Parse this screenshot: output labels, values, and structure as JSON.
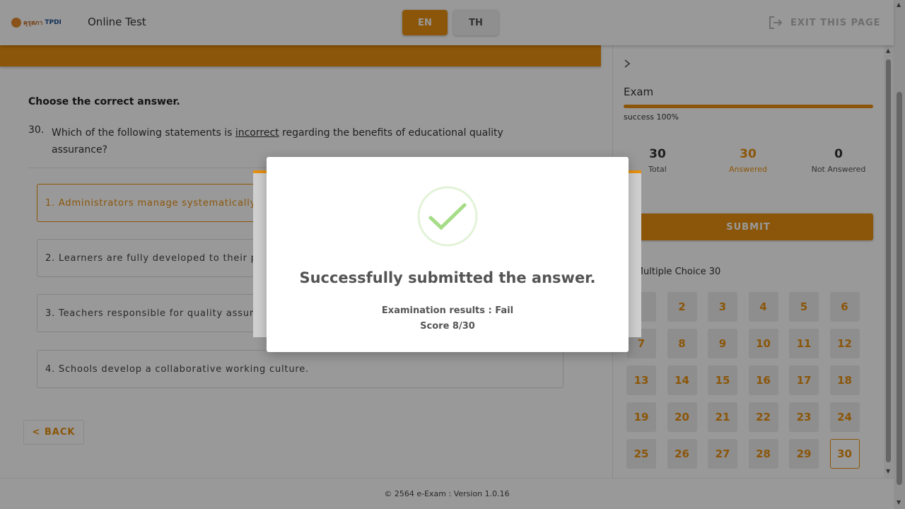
{
  "header": {
    "logo_text_a": "คุรุสภา",
    "logo_text_b": "TPDI",
    "app_title": "Online Test",
    "languages": [
      "EN",
      "TH"
    ],
    "active_language": "EN",
    "exit_label": "EXIT THIS PAGE"
  },
  "question": {
    "instruction": "Choose the correct answer.",
    "number": "30.",
    "text_before": "Which of the following statements is ",
    "text_emphasis": "incorrect",
    "text_after": " regarding the benefits of educational quality assurance?",
    "options": [
      "1. Administrators manage systematically",
      "2. Learners are fully developed to their p",
      "3. Teachers responsible for quality assur",
      "4. Schools develop a collaborative working culture."
    ],
    "selected_option": 1,
    "back_label": "< BACK"
  },
  "panel": {
    "exam_title": "Exam",
    "progress_label": "success 100%",
    "progress_fraction": 1.0,
    "stats": [
      {
        "value": "30",
        "label": "Total"
      },
      {
        "value": "30",
        "label": "Answered"
      },
      {
        "value": "0",
        "label": "Not Answered"
      }
    ],
    "submit_label": "SUBMIT",
    "section_title": "m Multiple Choice 30",
    "question_numbers": [
      "",
      "2",
      "3",
      "4",
      "5",
      "6",
      "7",
      "8",
      "9",
      "10",
      "11",
      "12",
      "13",
      "14",
      "15",
      "16",
      "17",
      "18",
      "19",
      "20",
      "21",
      "22",
      "23",
      "24",
      "25",
      "26",
      "27",
      "28",
      "29",
      "30"
    ],
    "current_question": "30"
  },
  "footer": {
    "text": "© 2564 e-Exam : Version 1.0.16"
  },
  "modal": {
    "title": "Successfully submitted the answer.",
    "result": "Examination results : Fail",
    "score": "Score 8/30"
  },
  "colors": {
    "accent": "#e8900f",
    "success_check": "#a5dc86"
  },
  "icons": {
    "exit": "exit-icon",
    "chevron": "chevron-right-icon",
    "success": "success-check-icon"
  }
}
